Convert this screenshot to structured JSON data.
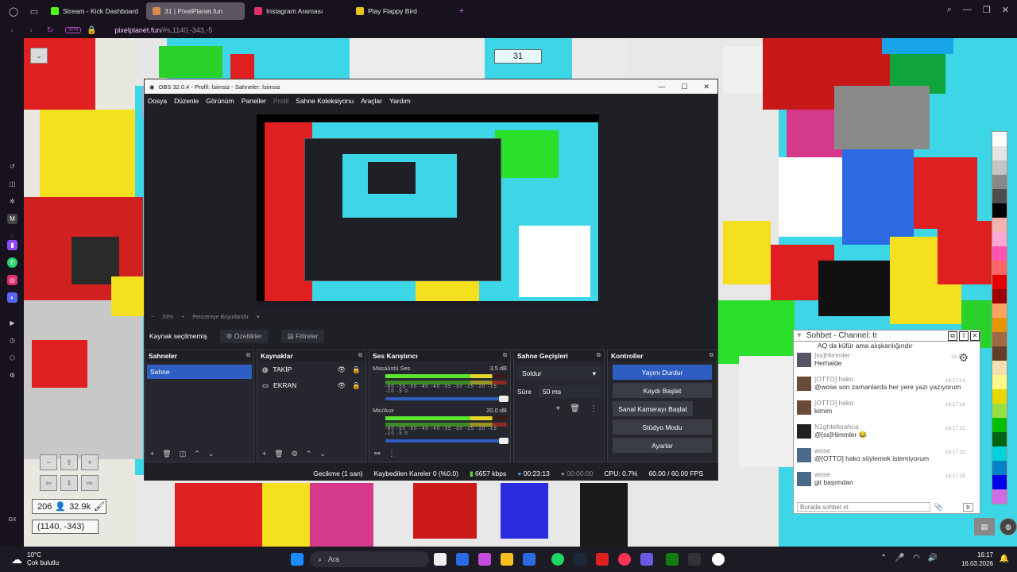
{
  "browser": {
    "tabs": [
      {
        "label": "Stream - Kick Dashboard",
        "fav": "#53fc18",
        "active": false
      },
      {
        "label": "31 | PixelPlanet.fun",
        "fav": "#d98c4a",
        "active": true
      },
      {
        "label": "Instagram Araması",
        "fav": "#e1306c",
        "active": false
      },
      {
        "label": "Play Flappy Bird",
        "fav": "#e7c51d",
        "active": false
      }
    ],
    "vpn": "VPN",
    "url_host": "pixelplanet.fun",
    "url_path": "/#s,1140,-343,-5",
    "ai_label": "AI"
  },
  "map": {
    "counter": "31",
    "online": "206",
    "pixels": "32.9k",
    "coords": "(1140, -343)",
    "sidebar_label": "GX"
  },
  "obs": {
    "title": "OBS 32.0.4 - Profil: İsimsiz - Sahneler: İsimsiz",
    "menu": [
      "Dosya",
      "Düzenle",
      "Görünüm",
      "Paneller",
      "Profil",
      "Sahne Koleksiyonu",
      "Araçlar",
      "Yardım"
    ],
    "zoom": "33%",
    "fit_label": "Pencereye Boyutlandır",
    "no_source": "Kaynak seçilmemiş",
    "props_btn": "Özellikler",
    "filters_btn": "Filtreler",
    "docks": {
      "scenes": {
        "title": "Sahneler",
        "items": [
          "Sahne"
        ]
      },
      "sources": {
        "title": "Kaynaklar",
        "items": [
          "TAKİP",
          "EKRAN"
        ]
      },
      "mixer": {
        "title": "Ses Karıştırıcı",
        "channels": [
          {
            "name": "Masaüstü Ses",
            "db": "3.5 dB"
          },
          {
            "name": "Mic/Aux",
            "db": "20.0 dB"
          }
        ],
        "ticks": "-60 -55 -50 -45 -40 -35 -30 -25 -20 -15 -10 -5 0"
      },
      "transitions": {
        "title": "Sahne Geçişleri",
        "type": "Soldur",
        "duration_label": "Süre",
        "duration": "50 ms"
      },
      "controls": {
        "title": "Kontroller",
        "buttons": [
          "Yayını Durdur",
          "Kaydı Başlat",
          "Sanal Kamerayı Başlat",
          "Stüdyo Modu",
          "Ayarlar"
        ]
      }
    },
    "status": {
      "delay": "Gecikme (1 san)",
      "dropped": "Kaybedilen Kareler 0 (%0.0)",
      "bitrate": "6657 kbps",
      "stream_time": "00:23:13",
      "rec_time": "00:00:00",
      "cpu": "CPU: 0.7%",
      "fps": "60.00 / 60.00 FPS"
    }
  },
  "chat": {
    "title": "Sohbet - Channel: tr",
    "top_line": "AQ da küfür ama alışkanlığındır",
    "messages": [
      {
        "name": "[ss]Himmler",
        "text": "Herhalde",
        "time": "16:17:"
      },
      {
        "name": "[OTTO] hako",
        "text": "@wose son zamanlarda her yere yazı yazıyorum",
        "time": "16:17:14"
      },
      {
        "name": "[OTTO] hako",
        "text": "kimim",
        "time": "16:17:16"
      },
      {
        "name": "N1ghteferahca",
        "text": "@[ss]Himmler 😂",
        "time": "16:17:22"
      },
      {
        "name": "wose",
        "text": "@[OTTO] hako söylemek istemiyorum",
        "time": "16:17:22"
      },
      {
        "name": "wose",
        "text": "git başımdan",
        "time": "16:17:25"
      }
    ],
    "placeholder": "Burada sohbet et"
  },
  "taskbar": {
    "temp": "10°C",
    "weather": "Çok bulutlu",
    "search": "Ara",
    "time": "16:17",
    "date": "16.03.2026"
  }
}
